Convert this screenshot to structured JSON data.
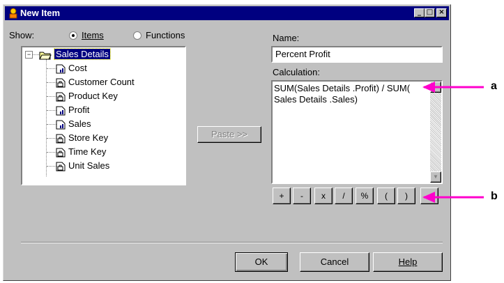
{
  "window": {
    "title": "New Item"
  },
  "show": {
    "label": "Show:",
    "options": [
      {
        "label": "Items",
        "selected": true
      },
      {
        "label": "Functions",
        "selected": false
      }
    ]
  },
  "tree": {
    "root": {
      "label": "Sales Details",
      "expander": "⊟"
    },
    "children": [
      {
        "label": "Cost",
        "icon": "measure-icon"
      },
      {
        "label": "Customer Count",
        "icon": "key-icon"
      },
      {
        "label": "Product Key",
        "icon": "key-icon"
      },
      {
        "label": "Profit",
        "icon": "measure-icon"
      },
      {
        "label": "Sales",
        "icon": "measure-icon"
      },
      {
        "label": "Store Key",
        "icon": "key-icon"
      },
      {
        "label": "Time Key",
        "icon": "key-icon"
      },
      {
        "label": "Unit Sales",
        "icon": "key-icon"
      }
    ]
  },
  "paste_button": "Paste >>",
  "name": {
    "label": "Name:",
    "value": "Percent Profit"
  },
  "calculation": {
    "label": "Calculation:",
    "value": "SUM(Sales Details .Profit) / SUM( Sales Details .Sales)"
  },
  "operators": [
    "+",
    "-",
    "x",
    "/",
    "%",
    "(",
    ")"
  ],
  "footer": {
    "ok": "OK",
    "cancel": "Cancel",
    "help": "Help"
  },
  "callouts": {
    "a": "a",
    "b": "b"
  },
  "colors": {
    "accent_arrow": "#ff00cc",
    "title_bar": "#000080",
    "selection": "#000080"
  }
}
